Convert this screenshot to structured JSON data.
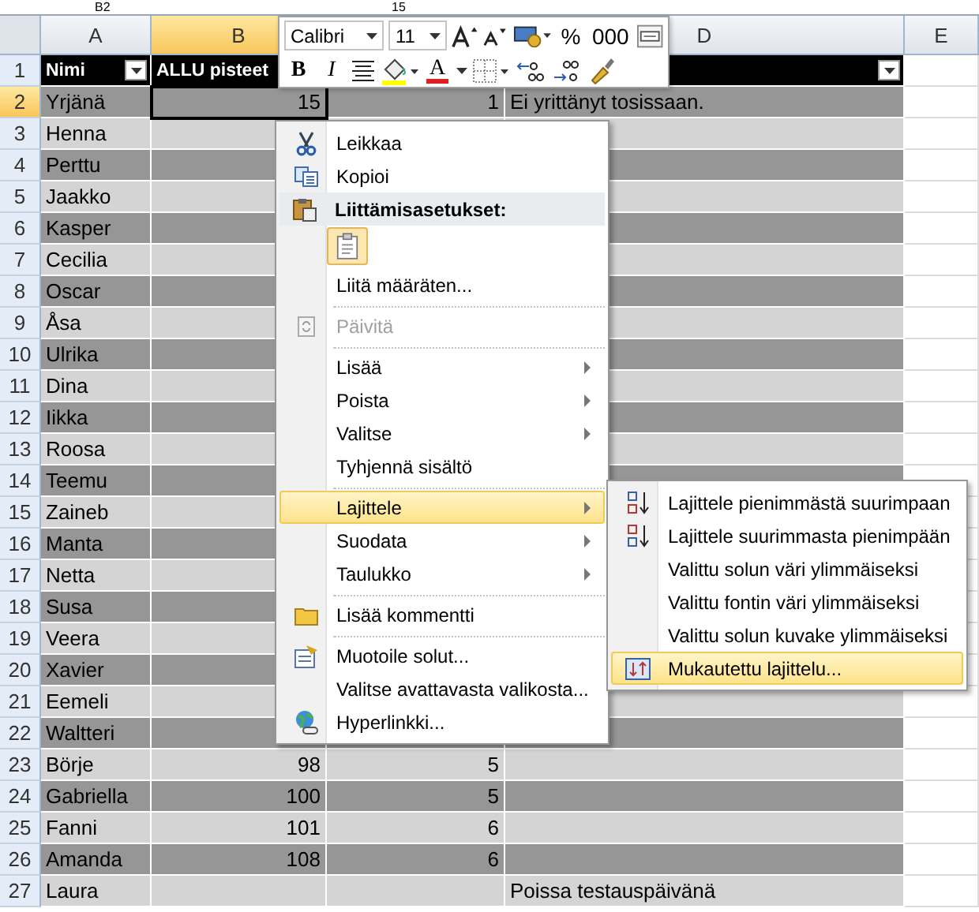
{
  "formula_bar": {
    "name_box": "B2",
    "value": "15"
  },
  "columns": [
    {
      "label": "A",
      "selected": false
    },
    {
      "label": "B",
      "selected": true
    },
    {},
    {
      "label": "D",
      "selected": false
    },
    {
      "label": "E",
      "selected": false
    }
  ],
  "header_row": {
    "number": "1",
    "selected": false,
    "a": "Nimi",
    "b": "ALLU pisteet"
  },
  "rows": [
    {
      "number": "2",
      "selected": true,
      "a": "Yrjänä",
      "b": "15",
      "c": "1",
      "d": "Ei yrittänyt tosissaan."
    },
    {
      "number": "3",
      "selected": false,
      "a": "Henna"
    },
    {
      "number": "4",
      "selected": false,
      "a": "Perttu"
    },
    {
      "number": "5",
      "selected": false,
      "a": "Jaakko"
    },
    {
      "number": "6",
      "selected": false,
      "a": "Kasper"
    },
    {
      "number": "7",
      "selected": false,
      "a": "Cecilia"
    },
    {
      "number": "8",
      "selected": false,
      "a": "Oscar"
    },
    {
      "number": "9",
      "selected": false,
      "a": "Åsa"
    },
    {
      "number": "10",
      "selected": false,
      "a": "Ulrika"
    },
    {
      "number": "11",
      "selected": false,
      "a": "Dina"
    },
    {
      "number": "12",
      "selected": false,
      "a": "Iikka"
    },
    {
      "number": "13",
      "selected": false,
      "a": "Roosa"
    },
    {
      "number": "14",
      "selected": false,
      "a": "Teemu"
    },
    {
      "number": "15",
      "selected": false,
      "a": "Zaineb"
    },
    {
      "number": "16",
      "selected": false,
      "a": "Manta"
    },
    {
      "number": "17",
      "selected": false,
      "a": "Netta"
    },
    {
      "number": "18",
      "selected": false,
      "a": "Susa"
    },
    {
      "number": "19",
      "selected": false,
      "a": "Veera"
    },
    {
      "number": "20",
      "selected": false,
      "a": "Xavier"
    },
    {
      "number": "21",
      "selected": false,
      "a": "Eemeli"
    },
    {
      "number": "22",
      "selected": false,
      "a": "Waltteri"
    },
    {
      "number": "23",
      "selected": false,
      "a": "Börje",
      "b": "98",
      "c": "5"
    },
    {
      "number": "24",
      "selected": false,
      "a": "Gabriella",
      "b": "100",
      "c": "5"
    },
    {
      "number": "25",
      "selected": false,
      "a": "Fanni",
      "b": "101",
      "c": "6"
    },
    {
      "number": "26",
      "selected": false,
      "a": "Amanda",
      "b": "108",
      "c": "6"
    },
    {
      "number": "27",
      "selected": false,
      "a": "Laura",
      "d": "Poissa testauspäivänä"
    }
  ],
  "mini_toolbar": {
    "font": "Calibri",
    "size": "11",
    "percent": "%",
    "thousands": "000",
    "bold": "B",
    "italic": "I",
    "font_color": "A"
  },
  "context_menu": [
    {
      "kind": "item",
      "label": "Leikkaa",
      "submenu": false,
      "disabled": false,
      "selected": false
    },
    {
      "kind": "item",
      "label": "Kopioi",
      "submenu": false,
      "disabled": false,
      "selected": false
    },
    {
      "kind": "header",
      "label": "Liittämisasetukset:"
    },
    {
      "kind": "paste-option"
    },
    {
      "kind": "item",
      "label": "Liitä määräten...",
      "submenu": false,
      "disabled": false,
      "selected": false
    },
    {
      "kind": "separator"
    },
    {
      "kind": "item",
      "label": "Päivitä",
      "submenu": false,
      "disabled": true,
      "selected": false
    },
    {
      "kind": "separator"
    },
    {
      "kind": "item",
      "label": "Lisää",
      "submenu": true,
      "disabled": false,
      "selected": false
    },
    {
      "kind": "item",
      "label": "Poista",
      "submenu": true,
      "disabled": false,
      "selected": false
    },
    {
      "kind": "item",
      "label": "Valitse",
      "submenu": true,
      "disabled": false,
      "selected": false
    },
    {
      "kind": "item",
      "label": "Tyhjennä sisältö",
      "submenu": false,
      "disabled": false,
      "selected": false
    },
    {
      "kind": "separator"
    },
    {
      "kind": "item",
      "label": "Lajittele",
      "submenu": true,
      "disabled": false,
      "selected": true
    },
    {
      "kind": "item",
      "label": "Suodata",
      "submenu": true,
      "disabled": false,
      "selected": false
    },
    {
      "kind": "item",
      "label": "Taulukko",
      "submenu": true,
      "disabled": false,
      "selected": false
    },
    {
      "kind": "separator"
    },
    {
      "kind": "item",
      "label": "Lisää kommentti",
      "submenu": false,
      "disabled": false,
      "selected": false
    },
    {
      "kind": "separator"
    },
    {
      "kind": "item",
      "label": "Muotoile solut...",
      "submenu": false,
      "disabled": false,
      "selected": false
    },
    {
      "kind": "item",
      "label": "Valitse avattavasta valikosta...",
      "submenu": false,
      "disabled": false,
      "selected": false
    },
    {
      "kind": "item",
      "label": "Hyperlinkki...",
      "submenu": false,
      "disabled": false,
      "selected": false
    }
  ],
  "submenu": [
    {
      "label": "Lajittele pienimmästä suurimpaan",
      "selected": false
    },
    {
      "label": "Lajittele suurimmasta pienimpään",
      "selected": false
    },
    {
      "label": "Valittu solun väri ylimmäiseksi",
      "selected": false
    },
    {
      "label": "Valittu fontin väri ylimmäiseksi",
      "selected": false
    },
    {
      "label": "Valittu solun kuvake ylimmäiseksi",
      "selected": false
    },
    {
      "label": "Mukautettu lajittelu...",
      "selected": true
    }
  ]
}
